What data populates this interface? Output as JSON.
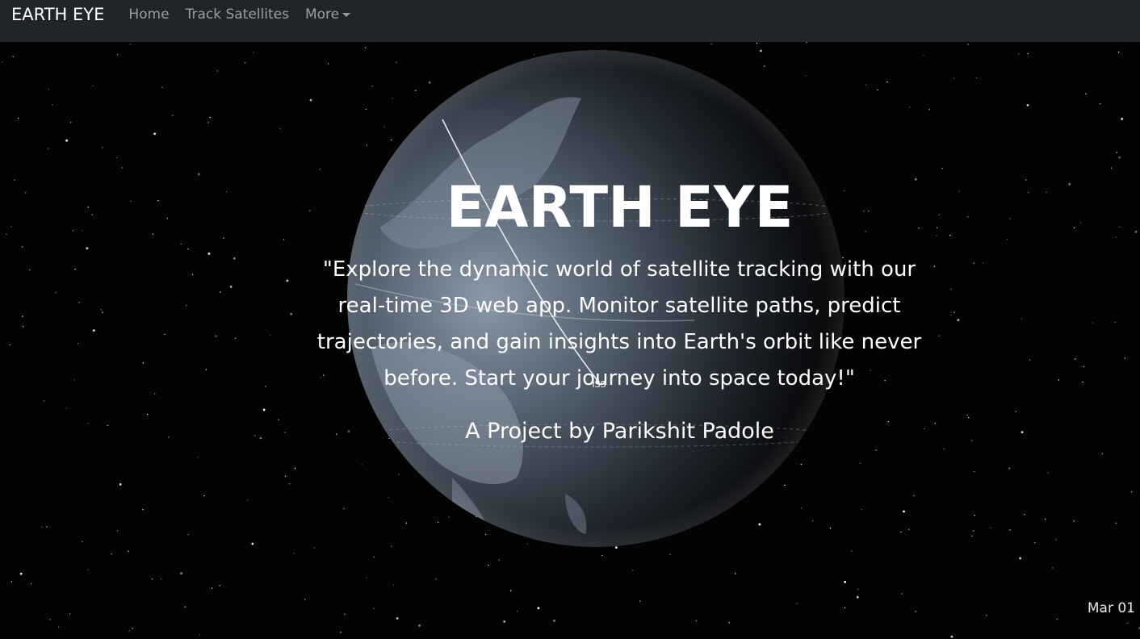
{
  "navbar": {
    "brand": "EARTH EYE",
    "links": [
      {
        "label": "Home"
      },
      {
        "label": "Track Satellites"
      },
      {
        "label": "More"
      }
    ]
  },
  "hero": {
    "title": "EARTH EYE",
    "quote": "\"Explore the dynamic world of satellite tracking with our real-time 3D web app. Monitor satellite paths, predict trajectories, and gain insights into Earth's orbit like never before. Start your journey into space today!\"",
    "credit": "A Project by Parikshit Padole"
  },
  "globe": {
    "satellite_label": "ISS"
  },
  "timeline": {
    "date": "Mar 01"
  },
  "colors": {
    "navbar_bg": "#212529",
    "space_bg": "#030303",
    "text": "#ffffff"
  }
}
